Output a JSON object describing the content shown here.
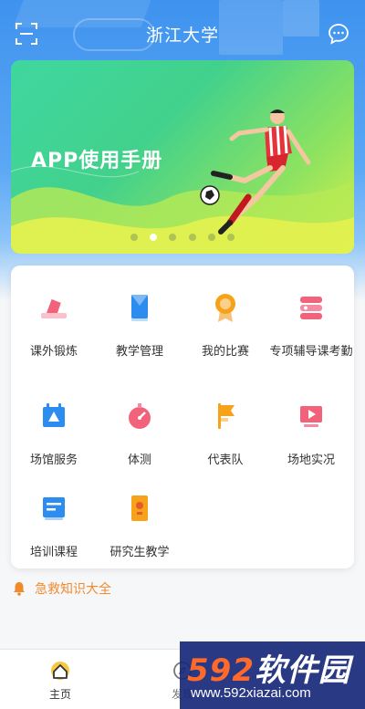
{
  "header": {
    "title": "浙江大学",
    "scan_icon": "scan-icon",
    "message_icon": "message-icon"
  },
  "banner": {
    "title": "APP使用手册",
    "dots_total": 6,
    "active_dot": 1
  },
  "menu": {
    "items": [
      {
        "label": "课外锻炼",
        "icon": "exercise-icon",
        "color": "#f2637b"
      },
      {
        "label": "教学管理",
        "icon": "teaching-icon",
        "color": "#2d8cf0"
      },
      {
        "label": "我的比赛",
        "icon": "medal-icon",
        "color": "#f7a21b"
      },
      {
        "label": "专项辅导课考勤",
        "icon": "attendance-icon",
        "color": "#f2637b"
      },
      {
        "label": "场馆服务",
        "icon": "calendar-icon",
        "color": "#2d8cf0"
      },
      {
        "label": "体测",
        "icon": "stopwatch-icon",
        "color": "#f2637b"
      },
      {
        "label": "代表队",
        "icon": "flag-icon",
        "color": "#f7a21b"
      },
      {
        "label": "场地实况",
        "icon": "video-icon",
        "color": "#f2637b"
      },
      {
        "label": "培训课程",
        "icon": "course-icon",
        "color": "#2d8cf0"
      },
      {
        "label": "研究生教学",
        "icon": "graduate-icon",
        "color": "#f7a21b"
      }
    ]
  },
  "first_aid": {
    "label": "急救知识大全",
    "icon": "bell-icon",
    "color": "#f08a2c"
  },
  "tabbar": {
    "tabs": [
      {
        "label": "主页",
        "icon": "home-icon",
        "active": true
      },
      {
        "label": "发现",
        "icon": "compass-icon",
        "active": false
      }
    ]
  },
  "watermark": {
    "brand_num": "592",
    "brand_text": "软件园",
    "url": "www.592xiazai.com"
  }
}
